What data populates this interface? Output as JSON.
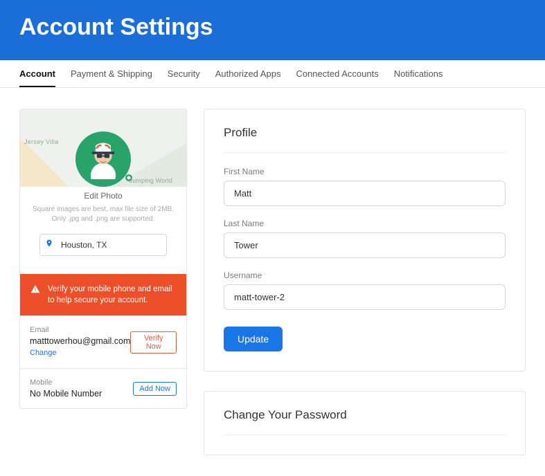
{
  "header": {
    "title": "Account Settings"
  },
  "tabs": [
    {
      "label": "Account",
      "active": true
    },
    {
      "label": "Payment & Shipping",
      "active": false
    },
    {
      "label": "Security",
      "active": false
    },
    {
      "label": "Authorized Apps",
      "active": false
    },
    {
      "label": "Connected Accounts",
      "active": false
    },
    {
      "label": "Notifications",
      "active": false
    }
  ],
  "sidebar": {
    "map": {
      "label_left": "Jersey Villa",
      "label_right": "Jumping World"
    },
    "edit_photo_label": "Edit Photo",
    "photo_hint": "Square images are best, max file size of 2MB. Only .jpg and .png are supported.",
    "location_value": "Houston, TX",
    "alert_text": "Verify your mobile phone and email to help secure your account.",
    "email": {
      "label": "Email",
      "value": "matttowerhou@gmail.com",
      "change_link": "Change",
      "verify_label": "Verify Now"
    },
    "mobile": {
      "label": "Mobile",
      "value": "No Mobile Number",
      "add_label": "Add Now"
    }
  },
  "profile": {
    "heading": "Profile",
    "first_name_label": "First Name",
    "first_name_value": "Matt",
    "last_name_label": "Last Name",
    "last_name_value": "Tower",
    "username_label": "Username",
    "username_value": "matt-tower-2",
    "update_label": "Update"
  },
  "password": {
    "heading": "Change Your Password"
  }
}
